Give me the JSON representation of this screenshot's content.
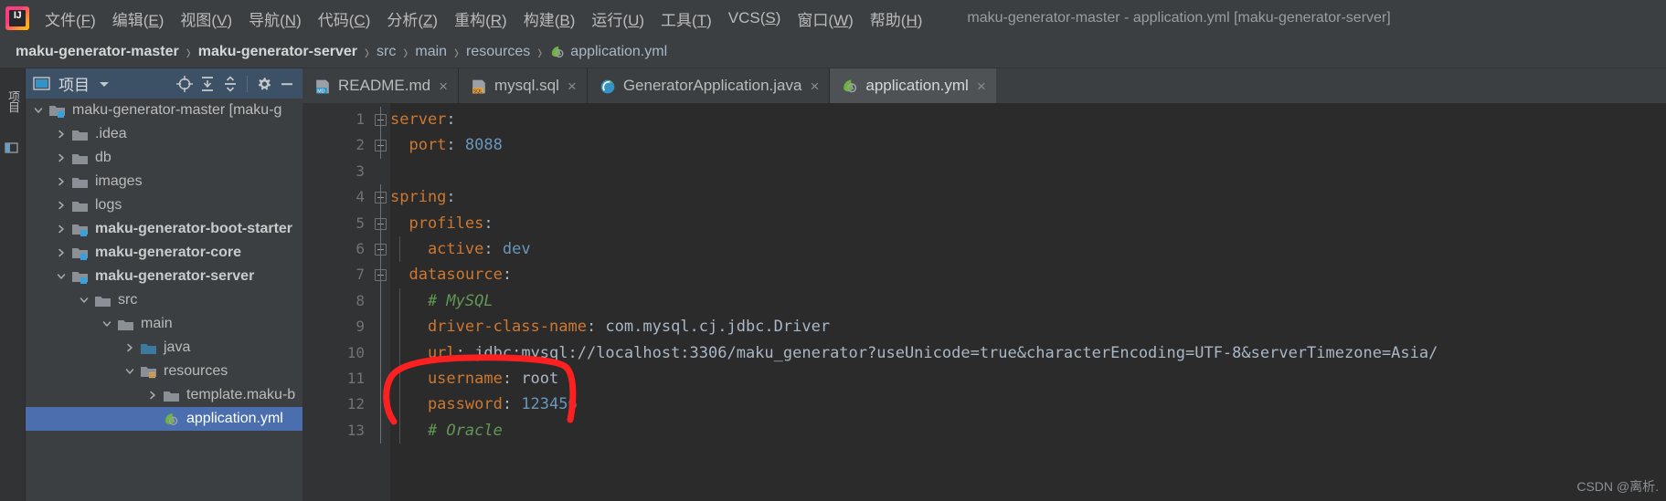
{
  "window": {
    "title": "maku-generator-master - application.yml [maku-generator-server]"
  },
  "menubar": {
    "logo_letters": "IJ",
    "items": [
      {
        "name": "file",
        "text": "文件",
        "key": "F"
      },
      {
        "name": "edit",
        "text": "编辑",
        "key": "E"
      },
      {
        "name": "view",
        "text": "视图",
        "key": "V"
      },
      {
        "name": "navigate",
        "text": "导航",
        "key": "N"
      },
      {
        "name": "code",
        "text": "代码",
        "key": "C"
      },
      {
        "name": "analyze",
        "text": "分析",
        "key": "Z"
      },
      {
        "name": "refactor",
        "text": "重构",
        "key": "R"
      },
      {
        "name": "build",
        "text": "构建",
        "key": "B"
      },
      {
        "name": "run",
        "text": "运行",
        "key": "U"
      },
      {
        "name": "tools",
        "text": "工具",
        "key": "T"
      },
      {
        "name": "vcs",
        "text": "VCS",
        "key": "S"
      },
      {
        "name": "window",
        "text": "窗口",
        "key": "W"
      },
      {
        "name": "help",
        "text": "帮助",
        "key": "H"
      }
    ]
  },
  "breadcrumb": {
    "items": [
      {
        "label": "maku-generator-master",
        "bold": true,
        "icon": ""
      },
      {
        "label": "maku-generator-server",
        "bold": true,
        "icon": ""
      },
      {
        "label": "src",
        "bold": false,
        "icon": ""
      },
      {
        "label": "main",
        "bold": false,
        "icon": ""
      },
      {
        "label": "resources",
        "bold": false,
        "icon": ""
      },
      {
        "label": "application.yml",
        "bold": false,
        "icon": "yaml-icon"
      }
    ],
    "separator": "›"
  },
  "toolstrip": {
    "vertical_tab_label": "项目",
    "structure_icon": "structure-icon"
  },
  "project_panel": {
    "title": "项目",
    "icons": [
      "project-view-icon",
      "chevron-down-icon",
      "locate-target-icon",
      "expand-all-icon",
      "collapse-all-icon",
      "gear-icon",
      "minimize-icon"
    ]
  },
  "tree": {
    "rows": [
      {
        "name": "tree-item-maku-generator-master",
        "label": "maku-generator-master [maku-g",
        "indent": 0,
        "arrow": "down",
        "icon": "module-folder-icon",
        "bold": false,
        "selected": false
      },
      {
        "name": "tree-item-idea",
        "label": ".idea",
        "indent": 1,
        "arrow": "right",
        "icon": "folder-icon",
        "bold": false,
        "selected": false
      },
      {
        "name": "tree-item-db",
        "label": "db",
        "indent": 1,
        "arrow": "right",
        "icon": "folder-icon",
        "bold": false,
        "selected": false
      },
      {
        "name": "tree-item-images",
        "label": "images",
        "indent": 1,
        "arrow": "right",
        "icon": "folder-icon",
        "bold": false,
        "selected": false
      },
      {
        "name": "tree-item-logs",
        "label": "logs",
        "indent": 1,
        "arrow": "right",
        "icon": "folder-icon",
        "bold": false,
        "selected": false
      },
      {
        "name": "tree-item-boot-starter",
        "label": "maku-generator-boot-starter",
        "indent": 1,
        "arrow": "right",
        "icon": "module-folder-icon",
        "bold": true,
        "selected": false
      },
      {
        "name": "tree-item-core",
        "label": "maku-generator-core",
        "indent": 1,
        "arrow": "right",
        "icon": "module-folder-icon",
        "bold": true,
        "selected": false
      },
      {
        "name": "tree-item-server",
        "label": "maku-generator-server",
        "indent": 1,
        "arrow": "down",
        "icon": "module-folder-icon",
        "bold": true,
        "selected": false
      },
      {
        "name": "tree-item-src",
        "label": "src",
        "indent": 2,
        "arrow": "down",
        "icon": "folder-icon",
        "bold": false,
        "selected": false
      },
      {
        "name": "tree-item-main",
        "label": "main",
        "indent": 3,
        "arrow": "down",
        "icon": "folder-icon",
        "bold": false,
        "selected": false
      },
      {
        "name": "tree-item-java",
        "label": "java",
        "indent": 4,
        "arrow": "right",
        "icon": "source-folder-icon",
        "bold": false,
        "selected": false
      },
      {
        "name": "tree-item-resources",
        "label": "resources",
        "indent": 4,
        "arrow": "down",
        "icon": "resource-folder-icon",
        "bold": false,
        "selected": false
      },
      {
        "name": "tree-item-template-maku",
        "label": "template.maku-b",
        "indent": 5,
        "arrow": "right",
        "icon": "folder-icon",
        "bold": false,
        "selected": false
      },
      {
        "name": "tree-item-application-yml",
        "label": "application.yml",
        "indent": 5,
        "arrow": "none",
        "icon": "yaml-icon",
        "bold": false,
        "selected": true
      }
    ]
  },
  "tabs": [
    {
      "name": "tab-readme",
      "label": "README.md",
      "icon": "markdown-icon",
      "active": false,
      "close": "×"
    },
    {
      "name": "tab-mysql-sql",
      "label": "mysql.sql",
      "icon": "sql-icon",
      "active": false,
      "close": "×"
    },
    {
      "name": "tab-generator-java",
      "label": "GeneratorApplication.java",
      "icon": "spring-icon",
      "active": false,
      "close": "×"
    },
    {
      "name": "tab-application-yml",
      "label": "application.yml",
      "icon": "yaml-icon",
      "active": true,
      "close": "×"
    }
  ],
  "editor": {
    "lines": [
      {
        "no": "1",
        "indent": 0,
        "fold": "start",
        "tokens": [
          {
            "t": "server",
            "c": "key"
          },
          {
            "t": ":",
            "c": "colon"
          }
        ]
      },
      {
        "no": "2",
        "indent": 1,
        "fold": "end",
        "tokens": [
          {
            "t": "  port",
            "c": "key"
          },
          {
            "t": ": ",
            "c": "colon"
          },
          {
            "t": "8088",
            "c": "num"
          }
        ]
      },
      {
        "no": "3",
        "indent": 0,
        "fold": "",
        "tokens": []
      },
      {
        "no": "4",
        "indent": 0,
        "fold": "start",
        "tokens": [
          {
            "t": "spring",
            "c": "key"
          },
          {
            "t": ":",
            "c": "colon"
          }
        ]
      },
      {
        "no": "5",
        "indent": 1,
        "fold": "start",
        "tokens": [
          {
            "t": "  profiles",
            "c": "key"
          },
          {
            "t": ":",
            "c": "colon"
          }
        ]
      },
      {
        "no": "6",
        "indent": 2,
        "fold": "end",
        "tokens": [
          {
            "t": "    active",
            "c": "key"
          },
          {
            "t": ": ",
            "c": "colon"
          },
          {
            "t": "dev",
            "c": "num"
          }
        ]
      },
      {
        "no": "7",
        "indent": 1,
        "fold": "start",
        "tokens": [
          {
            "t": "  datasource",
            "c": "key"
          },
          {
            "t": ":",
            "c": "colon"
          }
        ]
      },
      {
        "no": "8",
        "indent": 2,
        "fold": "",
        "tokens": [
          {
            "t": "    # MySQL",
            "c": "com"
          }
        ]
      },
      {
        "no": "9",
        "indent": 2,
        "fold": "",
        "tokens": [
          {
            "t": "    driver-class-name",
            "c": "key"
          },
          {
            "t": ": ",
            "c": "colon"
          },
          {
            "t": "com.mysql.cj.jdbc.Driver",
            "c": "plain"
          }
        ]
      },
      {
        "no": "10",
        "indent": 2,
        "fold": "",
        "tokens": [
          {
            "t": "    url",
            "c": "key"
          },
          {
            "t": ": ",
            "c": "colon"
          },
          {
            "t": "jdbc:mysql://localhost:3306/maku_generator?useUnicode=true&characterEncoding=UTF-8&serverTimezone=Asia/",
            "c": "plain"
          }
        ]
      },
      {
        "no": "11",
        "indent": 2,
        "fold": "",
        "tokens": [
          {
            "t": "    username",
            "c": "key"
          },
          {
            "t": ": ",
            "c": "colon"
          },
          {
            "t": "root",
            "c": "plain"
          }
        ]
      },
      {
        "no": "12",
        "indent": 2,
        "fold": "",
        "tokens": [
          {
            "t": "    password",
            "c": "key"
          },
          {
            "t": ": ",
            "c": "colon"
          },
          {
            "t": "123456",
            "c": "num"
          }
        ]
      },
      {
        "no": "13",
        "indent": 2,
        "fold": "",
        "tokens": [
          {
            "t": "    # Oracle",
            "c": "com"
          }
        ]
      }
    ]
  },
  "annotation": {
    "name": "red-ellipse-highlight",
    "color": "#fc2020",
    "covers": "username: root / password: 123456"
  },
  "watermark": {
    "text": "CSDN @离析."
  },
  "colors": {
    "menu_bg": "#3c3f41",
    "editor_bg": "#2b2b2b",
    "gutter_bg": "#313335",
    "selection_blue": "#4b6eaf",
    "panel_header_blue": "#3c5166",
    "keyword_orange": "#cc7832",
    "number_blue": "#6897bb",
    "comment_green": "#629755",
    "text_gray": "#a9b7c6",
    "annotation_red": "#fc2020"
  }
}
